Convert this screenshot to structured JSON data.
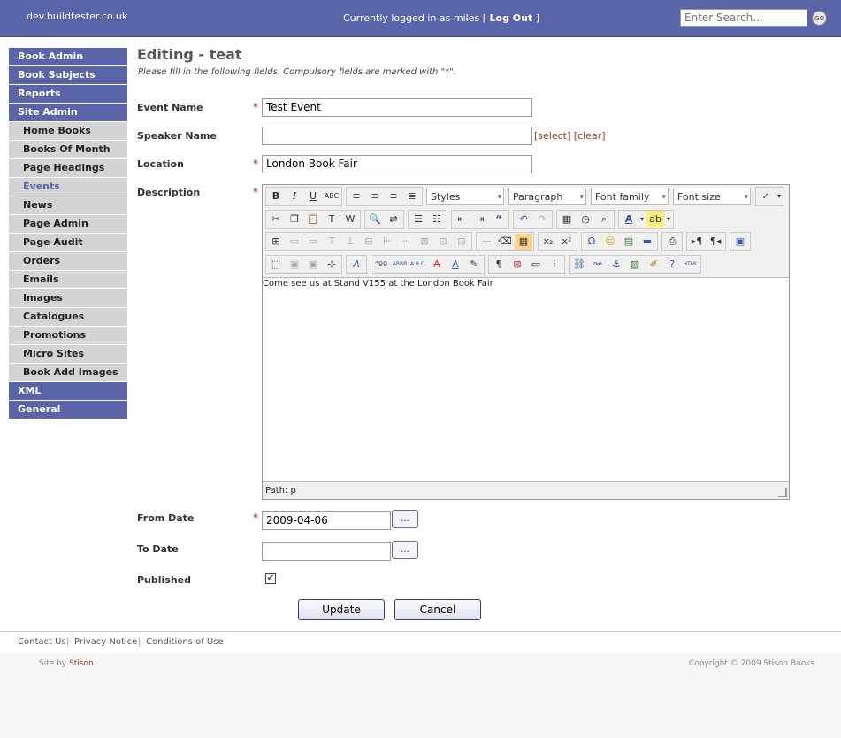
{
  "header": {
    "site": "dev.buildtester.co.uk",
    "logged_in": "Currently logged in as miles",
    "logout": "Log Out",
    "search_placeholder": "Enter Search...",
    "go": "GO"
  },
  "nav": [
    {
      "label": "Book Admin",
      "type": "parent"
    },
    {
      "label": "Book Subjects",
      "type": "parent"
    },
    {
      "label": "Reports",
      "type": "parent"
    },
    {
      "label": "Site Admin",
      "type": "parent"
    },
    {
      "label": "Home Books",
      "type": "child"
    },
    {
      "label": "Books Of Month",
      "type": "child"
    },
    {
      "label": "Page Headings",
      "type": "child"
    },
    {
      "label": "Events",
      "type": "child",
      "active": true
    },
    {
      "label": "News",
      "type": "child"
    },
    {
      "label": "Page Admin",
      "type": "child"
    },
    {
      "label": "Page Audit",
      "type": "child"
    },
    {
      "label": "Orders",
      "type": "child"
    },
    {
      "label": "Emails",
      "type": "child"
    },
    {
      "label": "Images",
      "type": "child"
    },
    {
      "label": "Catalogues",
      "type": "child"
    },
    {
      "label": "Promotions",
      "type": "child"
    },
    {
      "label": "Micro Sites",
      "type": "child"
    },
    {
      "label": "Book Add Images",
      "type": "child"
    },
    {
      "label": "XML",
      "type": "parent"
    },
    {
      "label": "General",
      "type": "parent"
    }
  ],
  "form": {
    "title": "Editing - teat",
    "intro": "Please fill in the following fields. Compulsory fields are marked with \"*\".",
    "required_mark": "*",
    "event_name_label": "Event Name",
    "event_name_value": "Test Event",
    "speaker_label": "Speaker Name",
    "speaker_value": "",
    "speaker_select": "[select]",
    "speaker_clear": "[clear]",
    "location_label": "Location",
    "location_value": "London Book Fair",
    "description_label": "Description",
    "editor": {
      "styles": "Styles",
      "format": "Paragraph",
      "font_family": "Font family",
      "font_size": "Font size",
      "content": "Come see us at Stand V155 at the London Book Fair",
      "path": "Path: p"
    },
    "from_label": "From Date",
    "from_value": "2009-04-06",
    "to_label": "To Date",
    "to_value": "",
    "picker": "...",
    "published_label": "Published",
    "published_checked": true,
    "update": "Update",
    "cancel": "Cancel"
  },
  "footer": {
    "links": [
      "Contact Us",
      "Privacy Notice",
      "Conditions of Use"
    ],
    "site_by": "Site by",
    "site_by_name": "Stison",
    "copyright": "Copyright © 2009 Stison Books"
  }
}
